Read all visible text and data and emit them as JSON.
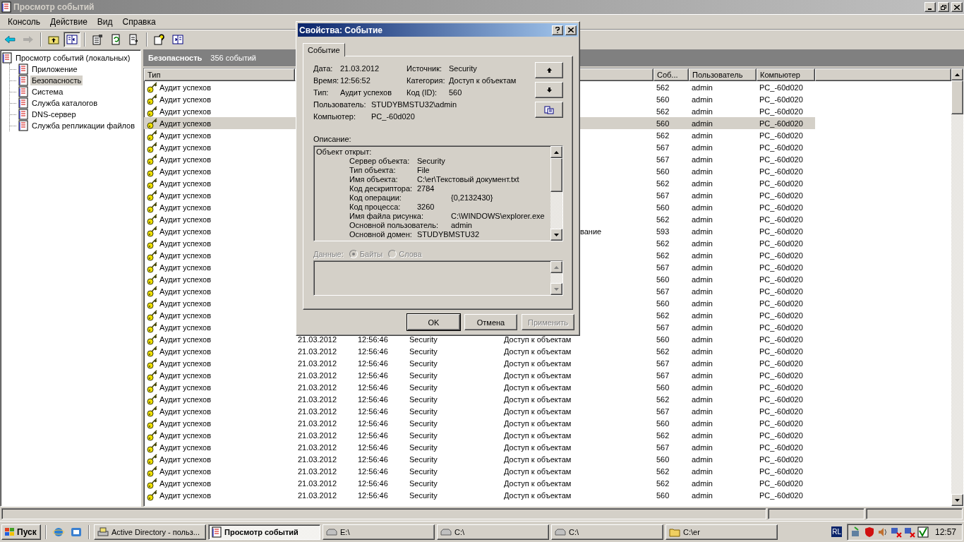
{
  "window": {
    "title": "Просмотр событий"
  },
  "menu": [
    "Консоль",
    "Действие",
    "Вид",
    "Справка"
  ],
  "toolbar": [
    {
      "disabled": false,
      "pressed": false
    },
    {
      "disabled": true,
      "pressed": false
    },
    {
      "disabled": false,
      "pressed": false
    },
    {
      "disabled": false,
      "pressed": true
    },
    {
      "disabled": false,
      "pressed": false
    },
    {
      "disabled": false,
      "pressed": false
    },
    {
      "disabled": false,
      "pressed": false
    },
    {
      "disabled": false,
      "pressed": false
    },
    {
      "disabled": false,
      "pressed": false
    }
  ],
  "tree": {
    "label": "Просмотр событий (локальных)",
    "expanded": true,
    "children": [
      {
        "label": "Приложение",
        "selected": false
      },
      {
        "label": "Безопасность",
        "selected": true
      },
      {
        "label": "Система",
        "selected": false
      },
      {
        "label": "Служба каталогов",
        "selected": false
      },
      {
        "label": "DNS-сервер",
        "selected": false
      },
      {
        "label": "Служба репликации файлов",
        "selected": false
      }
    ]
  },
  "pane": {
    "title": "Безопасность",
    "count": "356 событий"
  },
  "table": {
    "columns": [
      "Тип",
      "Соб...",
      "Пользователь",
      "Компьютер"
    ],
    "rows": [
      {
        "type": "Аудит успехов",
        "event": "562",
        "user": "admin",
        "computer": "PC_-60d020",
        "selected": false
      },
      {
        "type": "Аудит успехов",
        "event": "560",
        "user": "admin",
        "computer": "PC_-60d020",
        "selected": false
      },
      {
        "type": "Аудит успехов",
        "event": "562",
        "user": "admin",
        "computer": "PC_-60d020",
        "selected": false
      },
      {
        "type": "Аудит успехов",
        "event": "560",
        "user": "admin",
        "computer": "PC_-60d020",
        "selected": true
      },
      {
        "type": "Аудит успехов",
        "event": "562",
        "user": "admin",
        "computer": "PC_-60d020",
        "selected": false
      },
      {
        "type": "Аудит успехов",
        "event": "567",
        "user": "admin",
        "computer": "PC_-60d020",
        "selected": false
      },
      {
        "type": "Аудит успехов",
        "event": "567",
        "user": "admin",
        "computer": "PC_-60d020",
        "selected": false
      },
      {
        "type": "Аудит успехов",
        "event": "560",
        "user": "admin",
        "computer": "PC_-60d020",
        "selected": false
      },
      {
        "type": "Аудит успехов",
        "event": "562",
        "user": "admin",
        "computer": "PC_-60d020",
        "selected": false
      },
      {
        "type": "Аудит успехов",
        "event": "567",
        "user": "admin",
        "computer": "PC_-60d020",
        "selected": false
      },
      {
        "type": "Аудит успехов",
        "event": "560",
        "user": "admin",
        "computer": "PC_-60d020",
        "selected": false
      },
      {
        "type": "Аудит успехов",
        "event": "562",
        "user": "admin",
        "computer": "PC_-60d020",
        "selected": false
      },
      {
        "type": "Аудит успехов",
        "category_tail": "вание",
        "event": "593",
        "user": "admin",
        "computer": "PC_-60d020",
        "selected": false
      },
      {
        "type": "Аудит успехов",
        "event": "562",
        "user": "admin",
        "computer": "PC_-60d020",
        "selected": false
      },
      {
        "type": "Аудит успехов",
        "event": "562",
        "user": "admin",
        "computer": "PC_-60d020",
        "selected": false
      },
      {
        "type": "Аудит успехов",
        "event": "567",
        "user": "admin",
        "computer": "PC_-60d020",
        "selected": false
      },
      {
        "type": "Аудит успехов",
        "event": "560",
        "user": "admin",
        "computer": "PC_-60d020",
        "selected": false
      },
      {
        "type": "Аудит успехов",
        "event": "567",
        "user": "admin",
        "computer": "PC_-60d020",
        "selected": false
      },
      {
        "type": "Аудит успехов",
        "event": "560",
        "user": "admin",
        "computer": "PC_-60d020",
        "selected": false
      },
      {
        "type": "Аудит успехов",
        "event": "562",
        "user": "admin",
        "computer": "PC_-60d020",
        "selected": false
      },
      {
        "type": "Аудит успехов",
        "event": "567",
        "user": "admin",
        "computer": "PC_-60d020",
        "selected": false
      },
      {
        "type": "Аудит успехов",
        "date": "21.03.2012",
        "time": "12:56:46",
        "source": "Security",
        "category": "Доступ к объектам",
        "event": "560",
        "user": "admin",
        "computer": "PC_-60d020",
        "selected": false
      },
      {
        "type": "Аудит успехов",
        "date": "21.03.2012",
        "time": "12:56:46",
        "source": "Security",
        "category": "Доступ к объектам",
        "event": "562",
        "user": "admin",
        "computer": "PC_-60d020",
        "selected": false
      },
      {
        "type": "Аудит успехов",
        "date": "21.03.2012",
        "time": "12:56:46",
        "source": "Security",
        "category": "Доступ к объектам",
        "event": "567",
        "user": "admin",
        "computer": "PC_-60d020",
        "selected": false
      },
      {
        "type": "Аудит успехов",
        "date": "21.03.2012",
        "time": "12:56:46",
        "source": "Security",
        "category": "Доступ к объектам",
        "event": "567",
        "user": "admin",
        "computer": "PC_-60d020",
        "selected": false
      },
      {
        "type": "Аудит успехов",
        "date": "21.03.2012",
        "time": "12:56:46",
        "source": "Security",
        "category": "Доступ к объектам",
        "event": "560",
        "user": "admin",
        "computer": "PC_-60d020",
        "selected": false
      },
      {
        "type": "Аудит успехов",
        "date": "21.03.2012",
        "time": "12:56:46",
        "source": "Security",
        "category": "Доступ к объектам",
        "event": "562",
        "user": "admin",
        "computer": "PC_-60d020",
        "selected": false
      },
      {
        "type": "Аудит успехов",
        "date": "21.03.2012",
        "time": "12:56:46",
        "source": "Security",
        "category": "Доступ к объектам",
        "event": "567",
        "user": "admin",
        "computer": "PC_-60d020",
        "selected": false
      },
      {
        "type": "Аудит успехов",
        "date": "21.03.2012",
        "time": "12:56:46",
        "source": "Security",
        "category": "Доступ к объектам",
        "event": "560",
        "user": "admin",
        "computer": "PC_-60d020",
        "selected": false
      },
      {
        "type": "Аудит успехов",
        "date": "21.03.2012",
        "time": "12:56:46",
        "source": "Security",
        "category": "Доступ к объектам",
        "event": "562",
        "user": "admin",
        "computer": "PC_-60d020",
        "selected": false
      },
      {
        "type": "Аудит успехов",
        "date": "21.03.2012",
        "time": "12:56:46",
        "source": "Security",
        "category": "Доступ к объектам",
        "event": "567",
        "user": "admin",
        "computer": "PC_-60d020",
        "selected": false
      },
      {
        "type": "Аудит успехов",
        "date": "21.03.2012",
        "time": "12:56:46",
        "source": "Security",
        "category": "Доступ к объектам",
        "event": "560",
        "user": "admin",
        "computer": "PC_-60d020",
        "selected": false
      },
      {
        "type": "Аудит успехов",
        "date": "21.03.2012",
        "time": "12:56:46",
        "source": "Security",
        "category": "Доступ к объектам",
        "event": "562",
        "user": "admin",
        "computer": "PC_-60d020",
        "selected": false
      },
      {
        "type": "Аудит успехов",
        "date": "21.03.2012",
        "time": "12:56:46",
        "source": "Security",
        "category": "Доступ к объектам",
        "event": "562",
        "user": "admin",
        "computer": "PC_-60d020",
        "selected": false
      },
      {
        "type": "Аудит успехов",
        "date": "21.03.2012",
        "time": "12:56:46",
        "source": "Security",
        "category": "Доступ к объектам",
        "event": "560",
        "user": "admin",
        "computer": "PC_-60d020",
        "selected": false
      }
    ]
  },
  "dialog": {
    "title": "Свойства: Событие",
    "tabs": [
      {
        "label": "Событие",
        "selected": true
      }
    ],
    "fields_left": [
      {
        "label": "Дата:",
        "value": "21.03.2012"
      },
      {
        "label": "Время:",
        "value": "12:56:52"
      },
      {
        "label": "Тип:",
        "value": "Аудит успехов"
      }
    ],
    "fields_right": [
      {
        "label": "Источник:",
        "value": "Security"
      },
      {
        "label": "Категория:",
        "value": "Доступ к объектам"
      },
      {
        "label": "Код (ID):",
        "value": "560"
      }
    ],
    "fields_wide": [
      {
        "label": "Пользователь:",
        "value": "STUDYBMSTU32\\admin"
      },
      {
        "label": "Компьютер:",
        "value": "PC_-60d020"
      }
    ],
    "description": {
      "label": "Описание:",
      "heading": "Объект открыт:",
      "lines": [
        {
          "label": "Сервер объекта:",
          "value": "Security",
          "kind": "near"
        },
        {
          "label": "Тип объекта:",
          "value": "File",
          "kind": "near"
        },
        {
          "label": "Имя объекта:",
          "value": "C:\\er\\Текстовый документ.txt",
          "kind": "near"
        },
        {
          "label": "Код дескриптора:",
          "value": "2784",
          "kind": "near"
        },
        {
          "label": "Код операции:",
          "value": "{0,2132430}",
          "kind": "far"
        },
        {
          "label": "Код процесса:",
          "value": "3260",
          "kind": "near"
        },
        {
          "label": "Имя файла рисунка:",
          "value": "C:\\WINDOWS\\explorer.exe",
          "kind": "far"
        },
        {
          "label": "Основной пользователь:",
          "value": "admin",
          "kind": "far"
        },
        {
          "label": "Основной домен:",
          "value": "STUDYBMSTU32",
          "kind": "near"
        }
      ]
    },
    "data": {
      "label": "Данные:",
      "disabled": true,
      "options": [
        {
          "label": "Байты",
          "checked": true
        },
        {
          "label": "Слова",
          "checked": false
        }
      ]
    },
    "buttons": [
      {
        "label": "OK",
        "default": true,
        "disabled": false
      },
      {
        "label": "Отмена",
        "default": false,
        "disabled": false
      },
      {
        "label": "Применить",
        "default": false,
        "disabled": true
      }
    ]
  },
  "taskbar": {
    "start": "Пуск",
    "tasks": [
      {
        "label": "Active Directory - польз...",
        "active": false
      },
      {
        "label": "Просмотр событий",
        "active": true
      },
      {
        "label": "E:\\",
        "active": false
      },
      {
        "label": "C:\\",
        "active": false
      },
      {
        "label": "C:\\",
        "active": false
      },
      {
        "label": "C:\\er",
        "active": false
      }
    ],
    "language": "RL",
    "clock": "12:57"
  }
}
